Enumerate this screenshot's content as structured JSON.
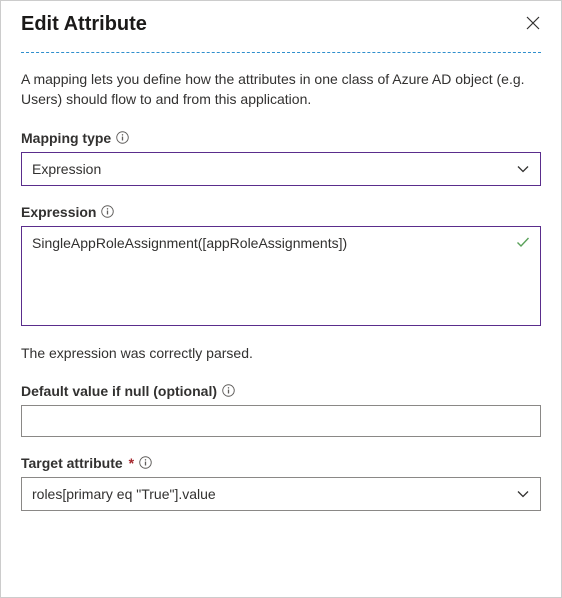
{
  "header": {
    "title": "Edit Attribute"
  },
  "description": "A mapping lets you define how the attributes in one class of Azure AD object (e.g. Users) should flow to and from this application.",
  "mappingType": {
    "label": "Mapping type",
    "value": "Expression"
  },
  "expression": {
    "label": "Expression",
    "value": "SingleAppRoleAssignment([appRoleAssignments])",
    "status": "The expression was correctly parsed."
  },
  "defaultValue": {
    "label": "Default value if null (optional)",
    "value": ""
  },
  "targetAttribute": {
    "label": "Target attribute",
    "value": "roles[primary eq \"True\"].value"
  }
}
